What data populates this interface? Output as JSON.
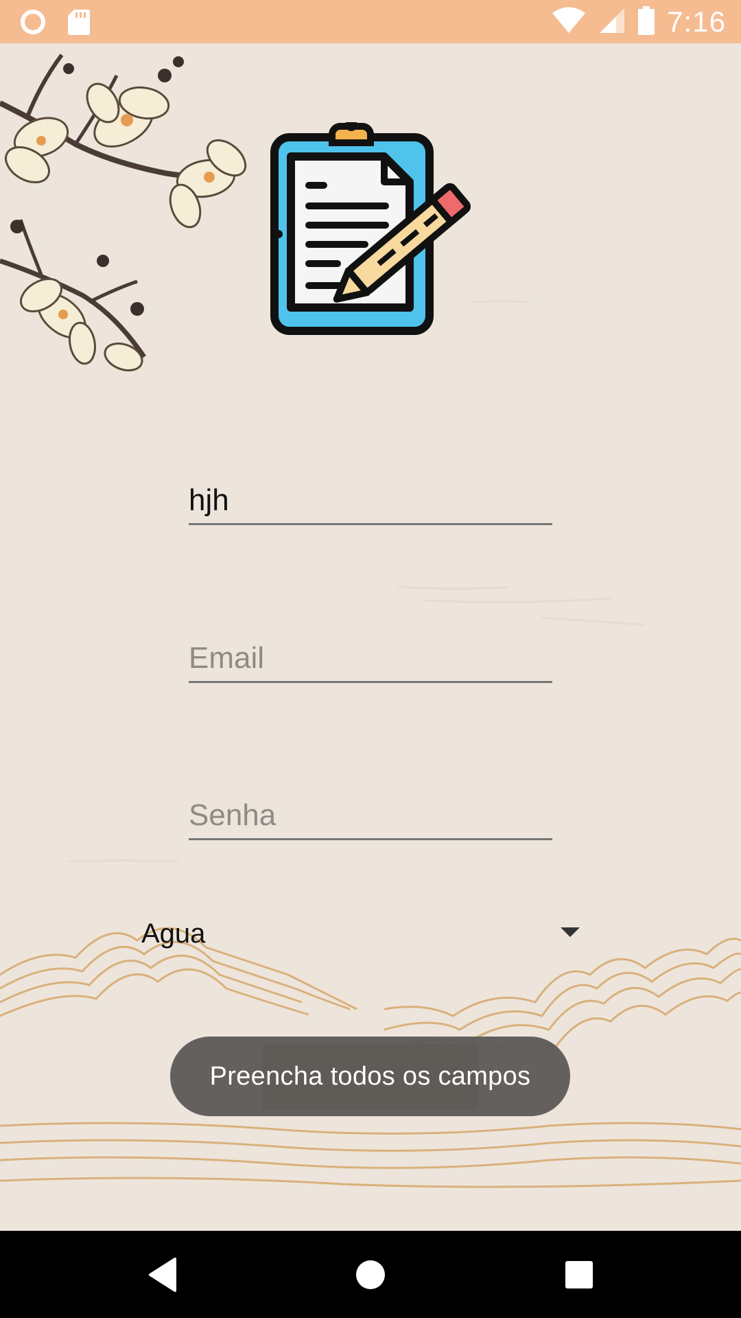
{
  "status_bar": {
    "time": "7:16",
    "icons": [
      "circle-notification-icon",
      "sd-card-icon",
      "wifi-icon",
      "signal-icon",
      "battery-icon"
    ]
  },
  "logo": {
    "icon": "clipboard-pencil-icon"
  },
  "form": {
    "name_value": "hjh",
    "email_placeholder": "Email",
    "email_value": "",
    "password_placeholder": "Senha",
    "password_value": "",
    "spinner_selected": "Agua"
  },
  "toast": {
    "message": "Preencha todos os campos"
  },
  "nav_bar": {
    "icons": [
      "back-icon",
      "home-icon",
      "recents-icon"
    ]
  },
  "colors": {
    "status_bar": "#f5bc91",
    "background": "#ede5db",
    "clipboard_blue": "#4fc3ec",
    "toast_bg": "#585654"
  }
}
